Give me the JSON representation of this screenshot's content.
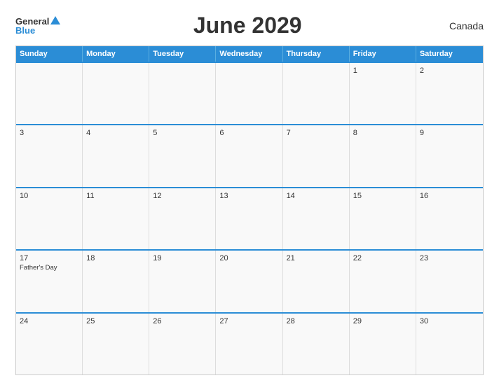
{
  "header": {
    "logo_general": "General",
    "logo_blue": "Blue",
    "title": "June 2029",
    "country": "Canada"
  },
  "weekdays": [
    "Sunday",
    "Monday",
    "Tuesday",
    "Wednesday",
    "Thursday",
    "Friday",
    "Saturday"
  ],
  "weeks": [
    [
      {
        "day": "",
        "event": ""
      },
      {
        "day": "",
        "event": ""
      },
      {
        "day": "",
        "event": ""
      },
      {
        "day": "",
        "event": ""
      },
      {
        "day": "",
        "event": ""
      },
      {
        "day": "1",
        "event": ""
      },
      {
        "day": "2",
        "event": ""
      }
    ],
    [
      {
        "day": "3",
        "event": ""
      },
      {
        "day": "4",
        "event": ""
      },
      {
        "day": "5",
        "event": ""
      },
      {
        "day": "6",
        "event": ""
      },
      {
        "day": "7",
        "event": ""
      },
      {
        "day": "8",
        "event": ""
      },
      {
        "day": "9",
        "event": ""
      }
    ],
    [
      {
        "day": "10",
        "event": ""
      },
      {
        "day": "11",
        "event": ""
      },
      {
        "day": "12",
        "event": ""
      },
      {
        "day": "13",
        "event": ""
      },
      {
        "day": "14",
        "event": ""
      },
      {
        "day": "15",
        "event": ""
      },
      {
        "day": "16",
        "event": ""
      }
    ],
    [
      {
        "day": "17",
        "event": "Father's Day"
      },
      {
        "day": "18",
        "event": ""
      },
      {
        "day": "19",
        "event": ""
      },
      {
        "day": "20",
        "event": ""
      },
      {
        "day": "21",
        "event": ""
      },
      {
        "day": "22",
        "event": ""
      },
      {
        "day": "23",
        "event": ""
      }
    ],
    [
      {
        "day": "24",
        "event": ""
      },
      {
        "day": "25",
        "event": ""
      },
      {
        "day": "26",
        "event": ""
      },
      {
        "day": "27",
        "event": ""
      },
      {
        "day": "28",
        "event": ""
      },
      {
        "day": "29",
        "event": ""
      },
      {
        "day": "30",
        "event": ""
      }
    ]
  ]
}
